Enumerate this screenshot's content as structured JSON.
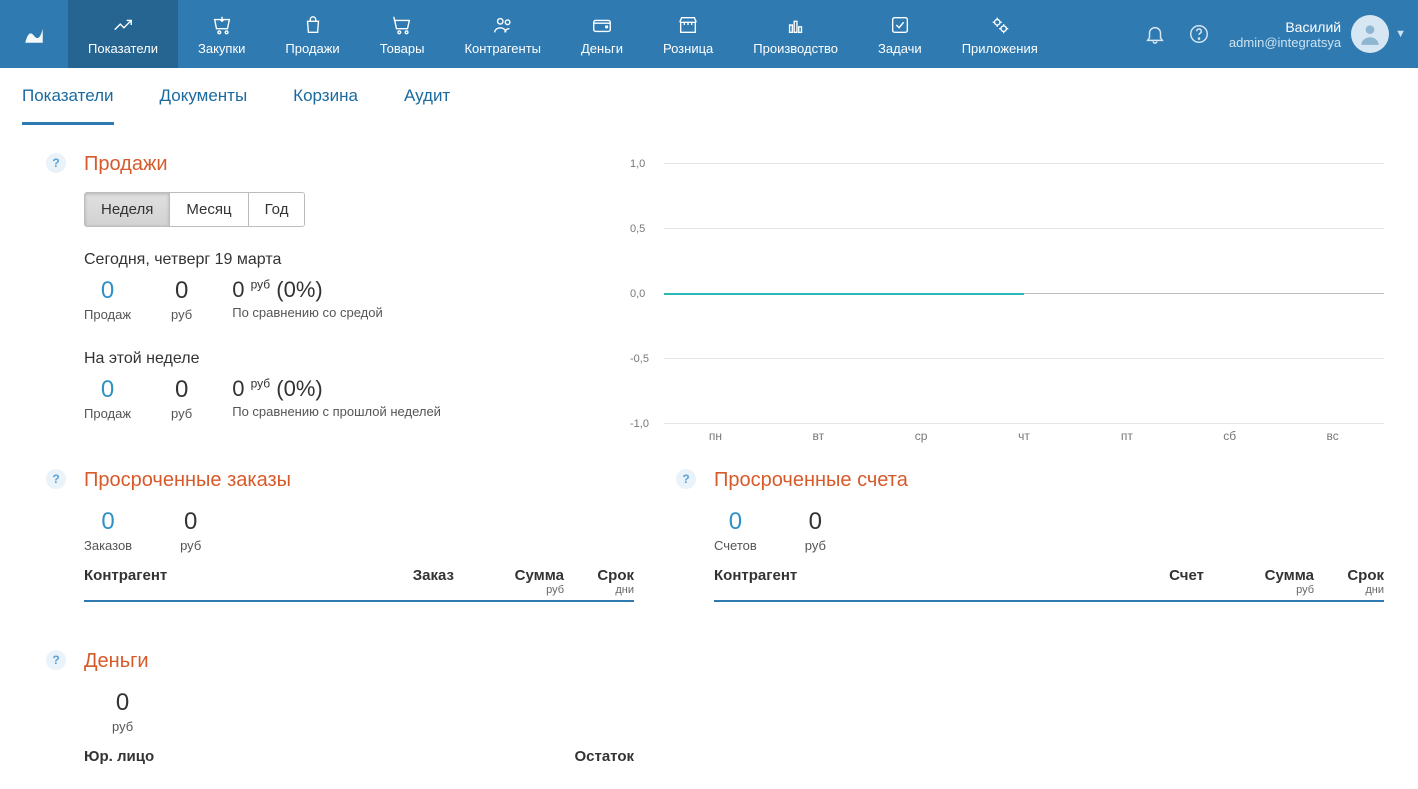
{
  "nav": [
    {
      "label": "Показатели"
    },
    {
      "label": "Закупки"
    },
    {
      "label": "Продажи"
    },
    {
      "label": "Товары"
    },
    {
      "label": "Контрагенты"
    },
    {
      "label": "Деньги"
    },
    {
      "label": "Розница"
    },
    {
      "label": "Производство"
    },
    {
      "label": "Задачи"
    },
    {
      "label": "Приложения"
    }
  ],
  "user": {
    "name": "Василий",
    "email": "admin@integratsya"
  },
  "subtabs": [
    {
      "label": "Показатели"
    },
    {
      "label": "Документы"
    },
    {
      "label": "Корзина"
    },
    {
      "label": "Аудит"
    }
  ],
  "sales": {
    "title": "Продажи",
    "periods": {
      "week": "Неделя",
      "month": "Месяц",
      "year": "Год"
    },
    "today_label": "Сегодня, четверг 19 марта",
    "today": {
      "count": "0",
      "count_label": "Продаж",
      "amount": "0",
      "amount_label": "руб",
      "delta": "0",
      "delta_unit": "руб",
      "delta_pct": "(0%)",
      "compare": "По сравнению со средой"
    },
    "week_label": "На этой неделе",
    "week": {
      "count": "0",
      "count_label": "Продаж",
      "amount": "0",
      "amount_label": "руб",
      "delta": "0",
      "delta_unit": "руб",
      "delta_pct": "(0%)",
      "compare": "По сравнению с прошлой неделей"
    }
  },
  "chart_data": {
    "type": "line",
    "categories": [
      "пн",
      "вт",
      "ср",
      "чт",
      "пт",
      "сб",
      "вс"
    ],
    "series": [
      {
        "name": "sales",
        "values": [
          0,
          0,
          0,
          0,
          null,
          null,
          null
        ]
      }
    ],
    "ylim": [
      -1.0,
      1.0
    ],
    "yticks": [
      "1,0",
      "0,5",
      "0,0",
      "-0,5",
      "-1,0"
    ]
  },
  "overdue_orders": {
    "title": "Просроченные заказы",
    "count": "0",
    "count_label": "Заказов",
    "amount": "0",
    "amount_label": "руб",
    "cols": {
      "party": "Контрагент",
      "order": "Заказ",
      "sum": "Сумма",
      "sum_unit": "руб",
      "due": "Срок",
      "due_unit": "дни"
    }
  },
  "overdue_invoices": {
    "title": "Просроченные счета",
    "count": "0",
    "count_label": "Счетов",
    "amount": "0",
    "amount_label": "руб",
    "cols": {
      "party": "Контрагент",
      "invoice": "Счет",
      "sum": "Сумма",
      "sum_unit": "руб",
      "due": "Срок",
      "due_unit": "дни"
    }
  },
  "money": {
    "title": "Деньги",
    "amount": "0",
    "amount_label": "руб",
    "cols": {
      "entity": "Юр. лицо",
      "balance": "Остаток"
    }
  },
  "help": "?"
}
